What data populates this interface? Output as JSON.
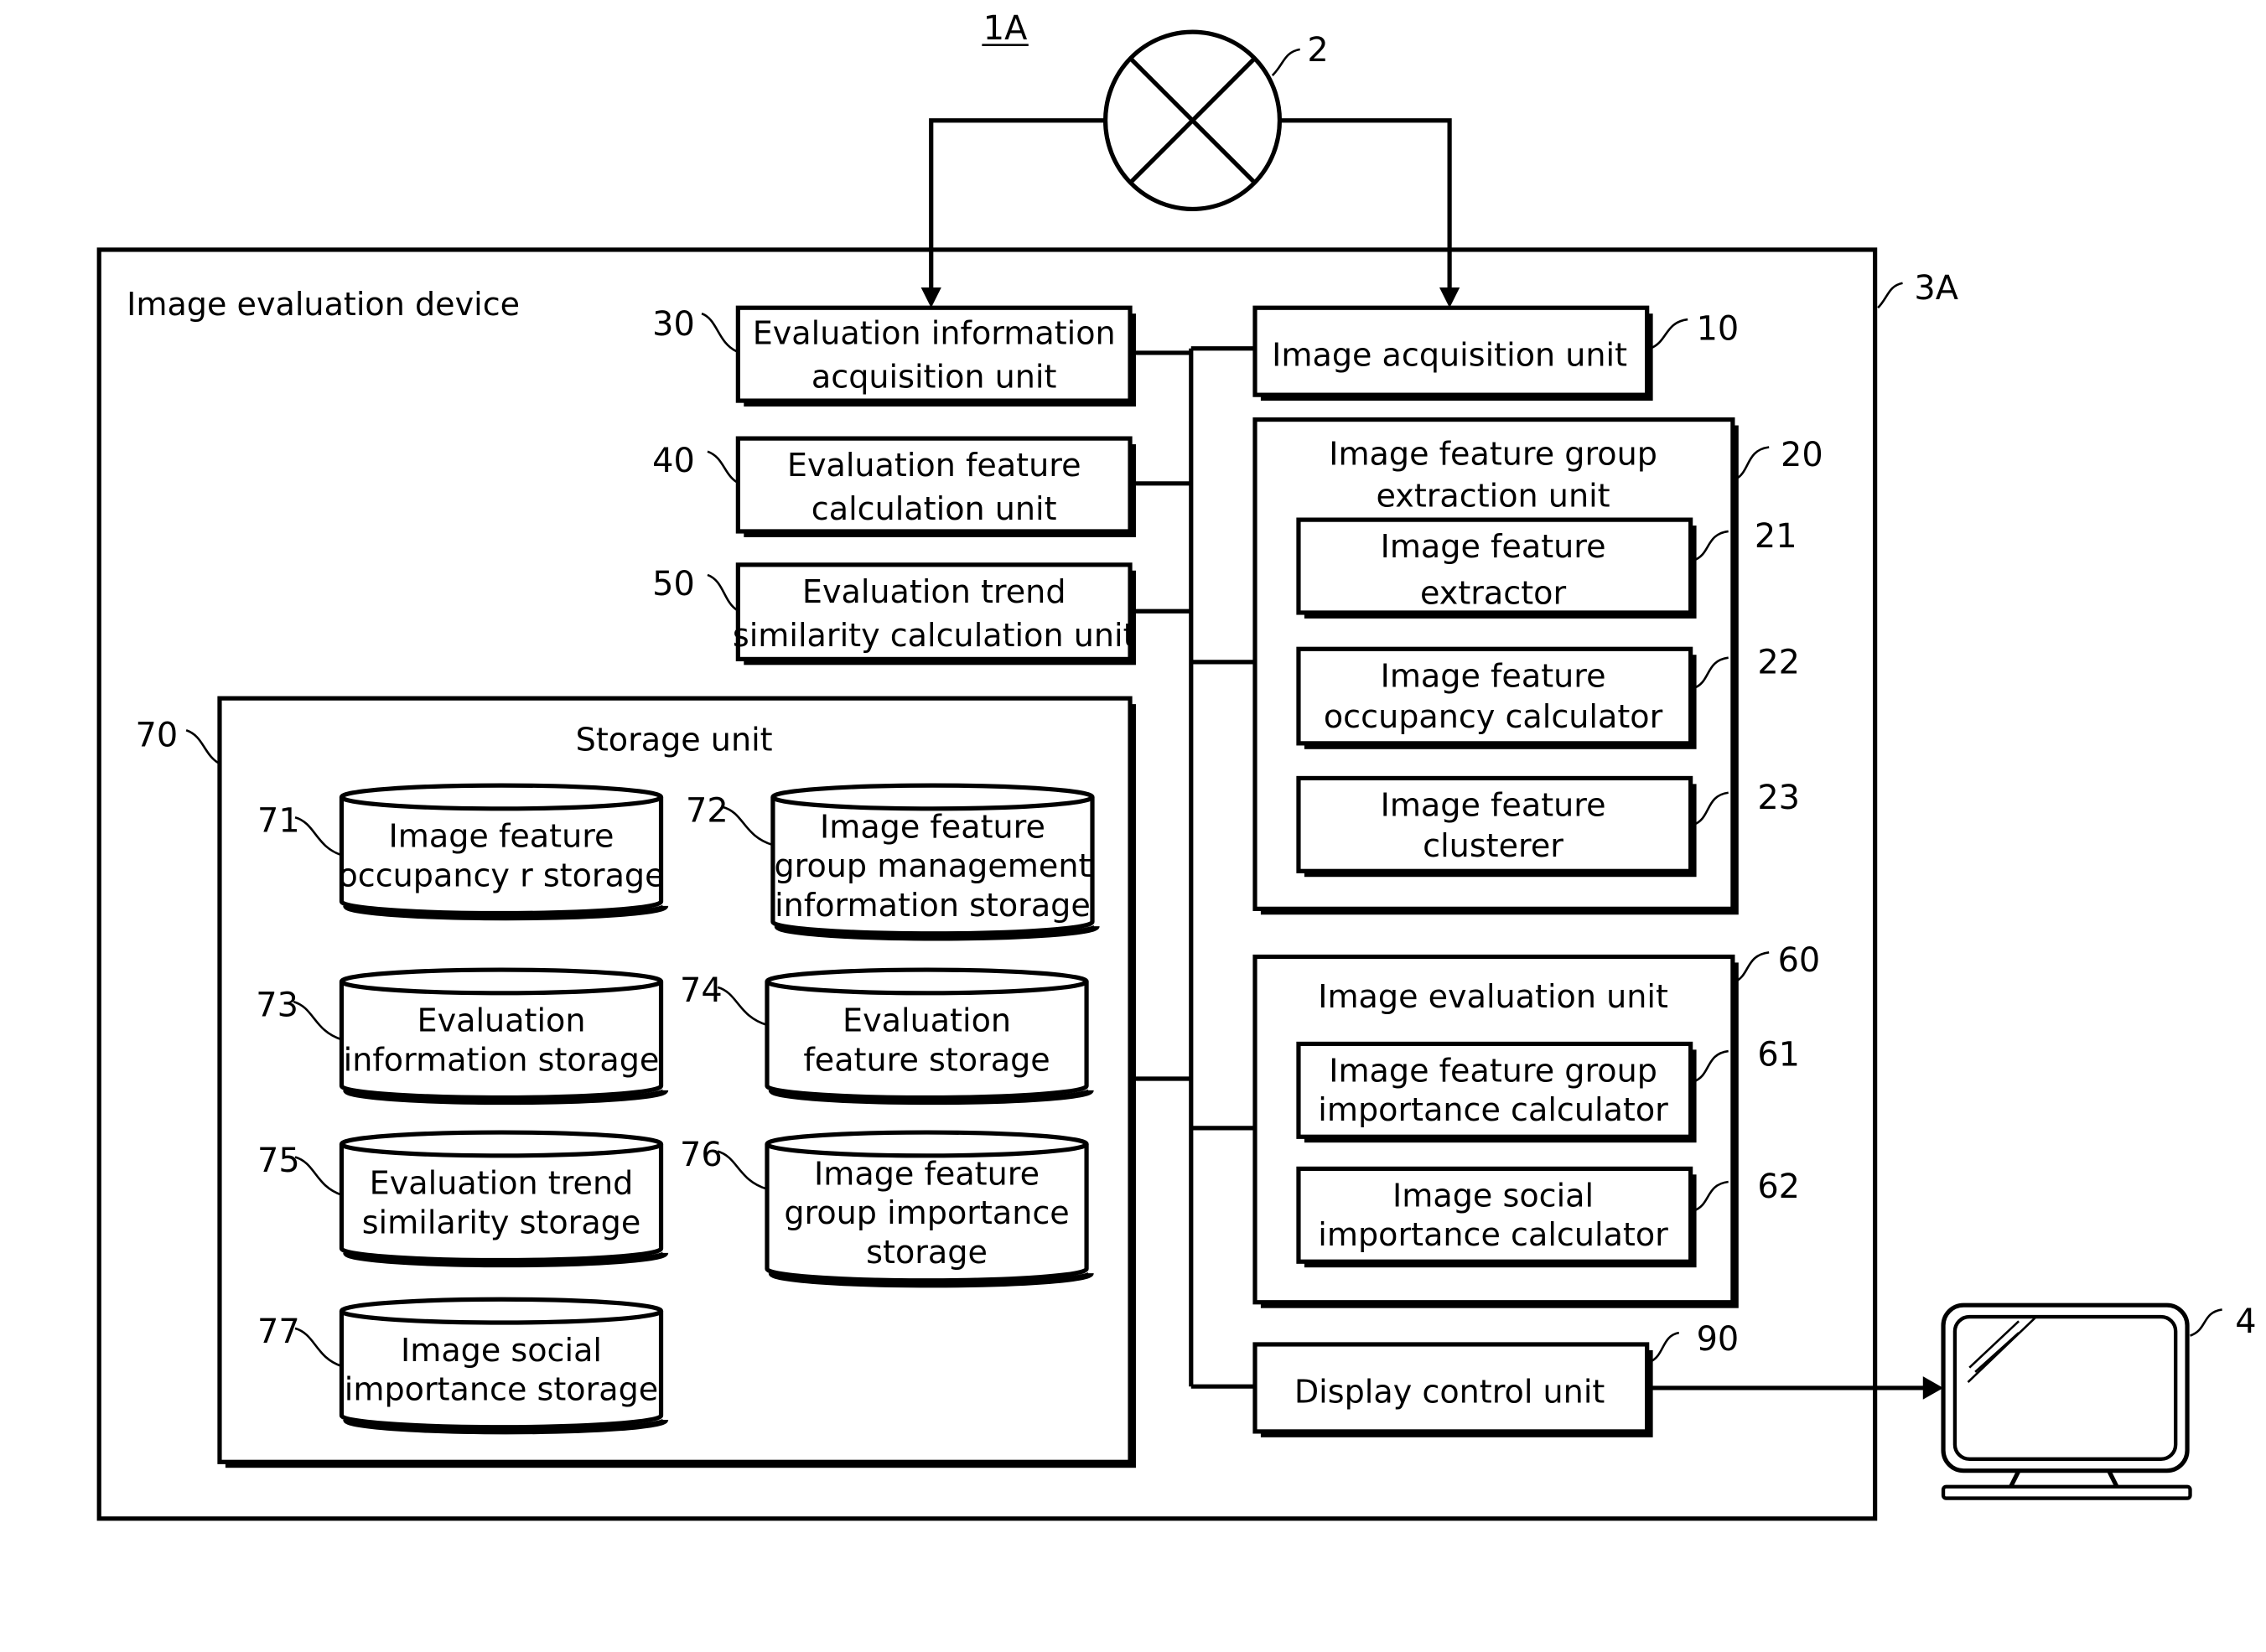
{
  "figure_label": "1A",
  "source": {
    "ref": "2"
  },
  "device": {
    "ref": "3A",
    "title": "Image evaluation device"
  },
  "display": {
    "ref": "4"
  },
  "units": {
    "u30": {
      "ref": "30",
      "lines": [
        "Evaluation information",
        "acquisition unit"
      ]
    },
    "u40": {
      "ref": "40",
      "lines": [
        "Evaluation feature",
        "calculation unit"
      ]
    },
    "u50": {
      "ref": "50",
      "lines": [
        "Evaluation trend",
        "similarity calculation unit"
      ]
    },
    "u10": {
      "ref": "10",
      "lines": [
        "Image acquisition unit"
      ]
    },
    "u20": {
      "ref": "20",
      "lines": [
        "Image feature group",
        "extraction unit"
      ]
    },
    "u21": {
      "ref": "21",
      "lines": [
        "Image feature",
        "extractor"
      ]
    },
    "u22": {
      "ref": "22",
      "lines": [
        "Image feature",
        "occupancy calculator"
      ]
    },
    "u23": {
      "ref": "23",
      "lines": [
        "Image feature",
        "clusterer"
      ]
    },
    "u60": {
      "ref": "60",
      "lines": [
        "Image evaluation unit"
      ]
    },
    "u61": {
      "ref": "61",
      "lines": [
        "Image feature group",
        "importance calculator"
      ]
    },
    "u62": {
      "ref": "62",
      "lines": [
        "Image social",
        "importance calculator"
      ]
    },
    "u90": {
      "ref": "90",
      "lines": [
        "Display control unit"
      ]
    },
    "u70": {
      "ref": "70",
      "lines": [
        "Storage unit"
      ]
    }
  },
  "storages": {
    "s71": {
      "ref": "71",
      "lines": [
        "Image feature",
        "occupancy r storage"
      ]
    },
    "s72": {
      "ref": "72",
      "lines": [
        "Image feature",
        "group management",
        "information storage"
      ]
    },
    "s73": {
      "ref": "73",
      "lines": [
        "Evaluation",
        "information storage"
      ]
    },
    "s74": {
      "ref": "74",
      "lines": [
        "Evaluation",
        "feature storage"
      ]
    },
    "s75": {
      "ref": "75",
      "lines": [
        "Evaluation trend",
        "similarity storage"
      ]
    },
    "s76": {
      "ref": "76",
      "lines": [
        "Image feature",
        "group importance",
        "storage"
      ]
    },
    "s77": {
      "ref": "77",
      "lines": [
        "Image social",
        "importance storage"
      ]
    }
  }
}
